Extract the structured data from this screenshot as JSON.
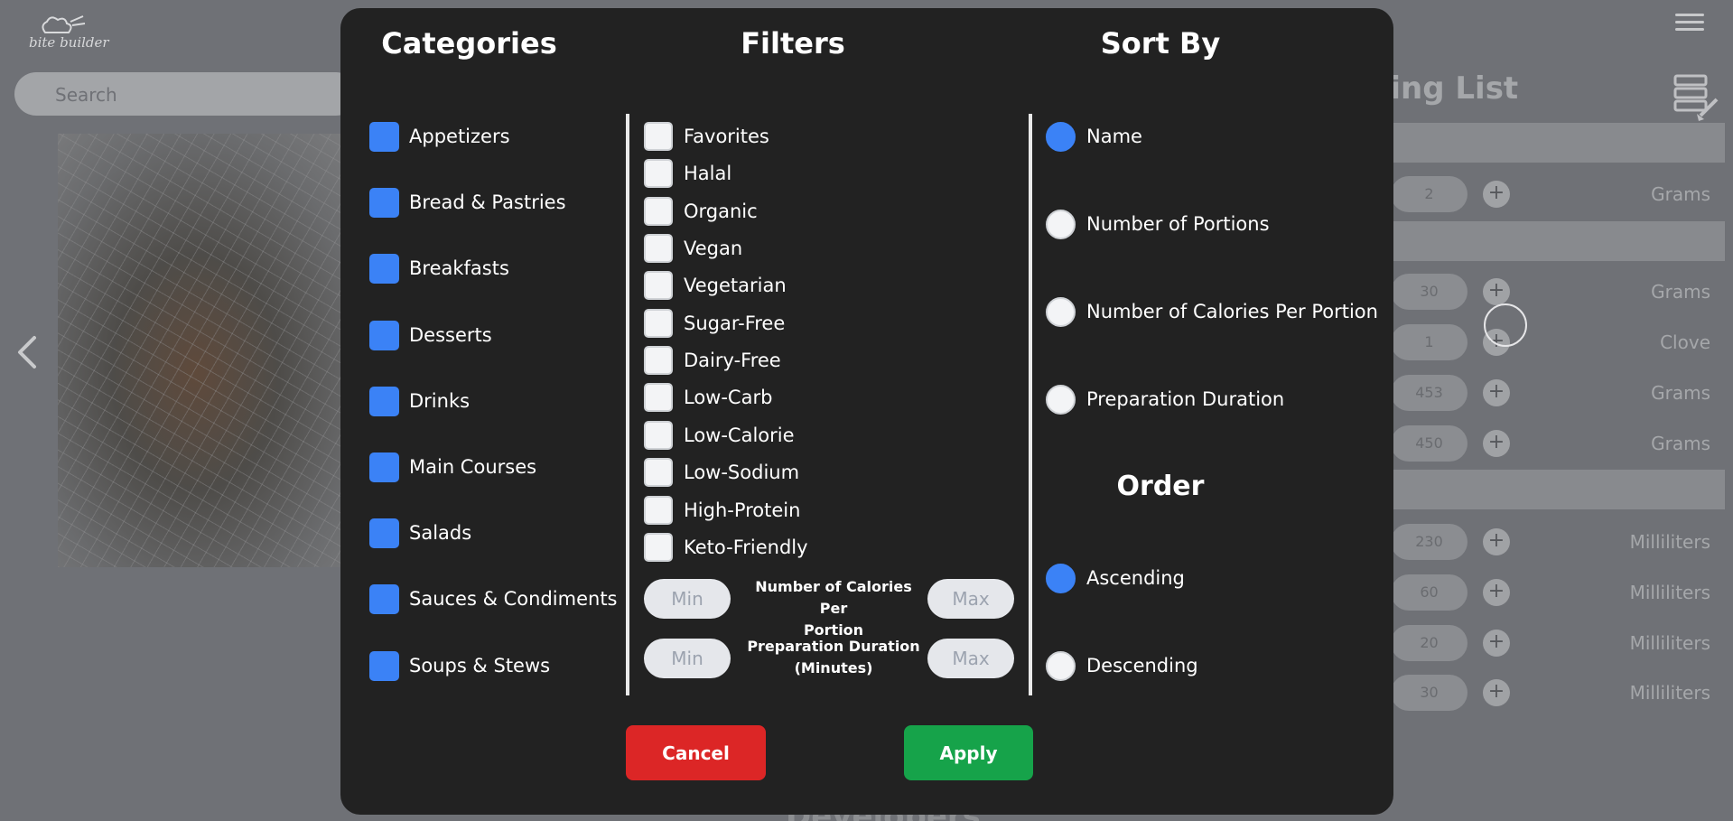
{
  "app": {
    "logo_text": "bite builder"
  },
  "search": {
    "placeholder": "Search"
  },
  "shopping_list": {
    "title_visible": "ping List",
    "rows": [
      {
        "qty": "2",
        "unit": "Grams"
      },
      {
        "qty": "30",
        "unit": "Grams"
      },
      {
        "qty": "1",
        "unit": "Clove"
      },
      {
        "qty": "453",
        "unit": "Grams"
      },
      {
        "qty": "450",
        "unit": "Grams"
      },
      {
        "qty": "230",
        "unit": "Milliliters"
      },
      {
        "qty": "60",
        "unit": "Milliliters"
      },
      {
        "qty": "20",
        "unit": "Milliliters"
      },
      {
        "qty": "30",
        "unit": "Milliliters"
      }
    ],
    "plus_symbol": "+"
  },
  "footer_peek": "Developers",
  "modal": {
    "categories_title": "Categories",
    "filters_title": "Filters",
    "sort_title": "Sort By",
    "order_title": "Order",
    "categories": [
      {
        "label": "Appetizers",
        "checked": true
      },
      {
        "label": "Bread & Pastries",
        "checked": true
      },
      {
        "label": "Breakfasts",
        "checked": true
      },
      {
        "label": "Desserts",
        "checked": true
      },
      {
        "label": "Drinks",
        "checked": true
      },
      {
        "label": "Main Courses",
        "checked": true
      },
      {
        "label": "Salads",
        "checked": true
      },
      {
        "label": "Sauces & Condiments",
        "checked": true
      },
      {
        "label": "Soups & Stews",
        "checked": true
      }
    ],
    "filters": [
      {
        "label": "Favorites",
        "checked": false
      },
      {
        "label": "Halal",
        "checked": false
      },
      {
        "label": "Organic",
        "checked": false
      },
      {
        "label": "Vegan",
        "checked": false
      },
      {
        "label": "Vegetarian",
        "checked": false
      },
      {
        "label": "Sugar-Free",
        "checked": false
      },
      {
        "label": "Dairy-Free",
        "checked": false
      },
      {
        "label": "Low-Carb",
        "checked": false
      },
      {
        "label": "Low-Calorie",
        "checked": false
      },
      {
        "label": "Low-Sodium",
        "checked": false
      },
      {
        "label": "High-Protein",
        "checked": false
      },
      {
        "label": "Keto-Friendly",
        "checked": false
      }
    ],
    "calorie_range": {
      "label_line1": "Number of Calories Per",
      "label_line2": "Portion",
      "min_placeholder": "Min",
      "max_placeholder": "Max"
    },
    "duration_range": {
      "label_line1": "Preparation Duration",
      "label_line2": "(Minutes)",
      "min_placeholder": "Min",
      "max_placeholder": "Max"
    },
    "sort_options": [
      {
        "label": "Name",
        "selected": true
      },
      {
        "label": "Number of Portions",
        "selected": false
      },
      {
        "label": "Number of Calories Per Portion",
        "selected": false
      },
      {
        "label": "Preparation Duration",
        "selected": false
      }
    ],
    "order_options": [
      {
        "label": "Ascending",
        "selected": true
      },
      {
        "label": "Descending",
        "selected": false
      }
    ],
    "cancel_label": "Cancel",
    "apply_label": "Apply"
  },
  "colors": {
    "accent": "#3b82f6",
    "cancel": "#dc2626",
    "apply": "#16a34a",
    "modal_bg": "#222222"
  },
  "icons": [
    "chef-hat-logo-icon",
    "chevron-left-icon",
    "hamburger-menu-icon",
    "shopping-list-clear-icon",
    "plus-icon"
  ]
}
